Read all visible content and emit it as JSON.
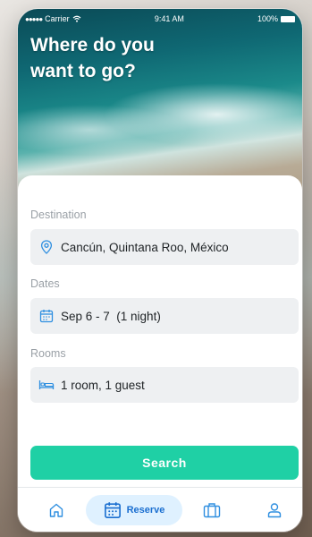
{
  "status_bar": {
    "carrier": "Carrier",
    "time": "9:41 AM",
    "battery": "100%"
  },
  "hero": {
    "headline_line1": "Where do you",
    "headline_line2": "want to go?"
  },
  "form": {
    "destination": {
      "label": "Destination",
      "value": "Cancún, Quintana Roo, México",
      "icon": "map-pin-icon"
    },
    "dates": {
      "label": "Dates",
      "value": "Sep 6 - 7  (1 night)",
      "icon": "calendar-icon"
    },
    "rooms": {
      "label": "Rooms",
      "value": "1 room, 1 guest",
      "icon": "bed-icon"
    },
    "search_label": "Search"
  },
  "tabbar": {
    "items": [
      {
        "icon": "home-icon",
        "label": ""
      },
      {
        "icon": "calendar-icon",
        "label": "Reserve",
        "active": true
      },
      {
        "icon": "suitcase-icon",
        "label": ""
      },
      {
        "icon": "user-icon",
        "label": ""
      }
    ]
  },
  "colors": {
    "accent": "#1fd0a5",
    "active_tab_bg": "#dff1ff",
    "active_tab_text": "#1b6fd0",
    "icon_blue": "#2f8fe0"
  }
}
